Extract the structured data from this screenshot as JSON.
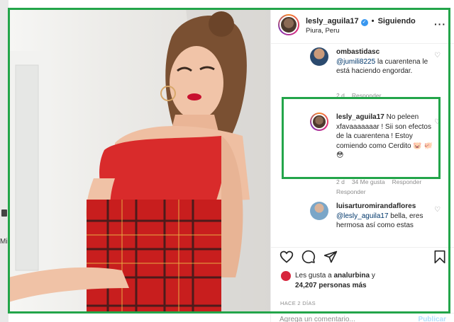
{
  "post": {
    "username": "lesly_aguila17",
    "follow_label": "Siguiendo",
    "location": "Piura, Peru",
    "more_label": "···"
  },
  "edge": {
    "text": "Mi"
  },
  "comments": [
    {
      "user": "ombastidasc",
      "mention": "@jumili8225",
      "text": " la cuarentena le está haciendo engordar.",
      "meta": [
        "2 d",
        "Responder"
      ]
    },
    {
      "user": "lesly_aguila17",
      "text": " No peleen xfavaaaaaaar ! Sii son efectos de la cuarentena ! Estoy comiendo como Cerdito 🐷 🐖 😳",
      "meta": [
        "2 d",
        "34 Me gusta",
        "Responder"
      ]
    },
    {
      "user": "luisarturomirandaflores",
      "mention": "@lesly_aguila17",
      "text": " bella, eres hermosa así como estas",
      "meta": []
    }
  ],
  "reply_label": "Responder",
  "likes": {
    "prefix": "Les gusta a ",
    "liker": "analurbina",
    "middle": " y",
    "count": "24,207 personas más"
  },
  "date": "HACE 2 DÍAS",
  "add_comment": {
    "placeholder": "Agrega un comentario...",
    "publish_label": "Publicar"
  },
  "colors": {
    "annotation": "#23a54a",
    "link": "#00376b",
    "verified": "#3897f0"
  },
  "icons": [
    "verified-badge-icon",
    "heart-icon",
    "comment-icon",
    "share-icon",
    "bookmark-icon",
    "more-options-icon"
  ]
}
